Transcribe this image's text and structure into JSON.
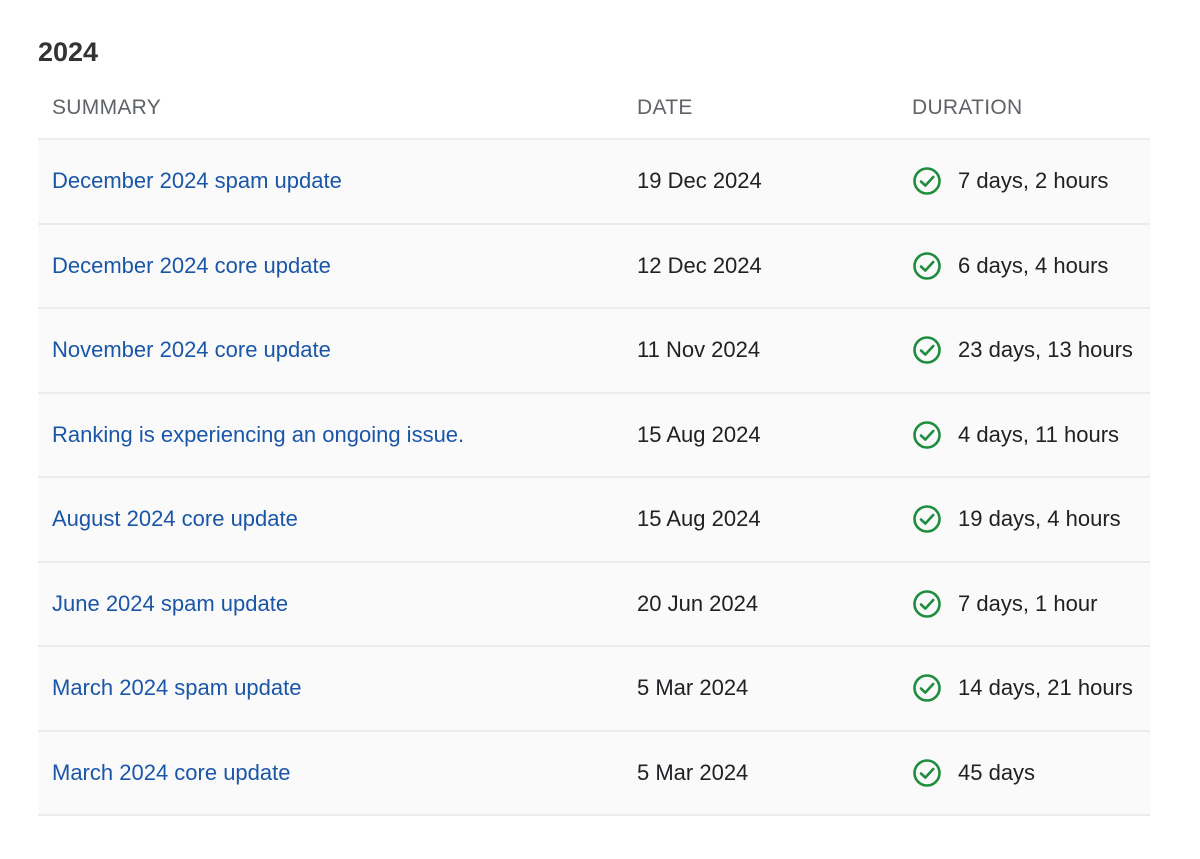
{
  "section": {
    "year": "2024"
  },
  "table": {
    "headers": {
      "summary": "SUMMARY",
      "date": "DATE",
      "duration": "DURATION"
    },
    "rows": [
      {
        "summary": "December 2024 spam update",
        "date": "19 Dec 2024",
        "duration": "7 days, 2 hours",
        "status_icon": "check-circle-icon"
      },
      {
        "summary": "December 2024 core update",
        "date": "12 Dec 2024",
        "duration": "6 days, 4 hours",
        "status_icon": "check-circle-icon"
      },
      {
        "summary": "November 2024 core update",
        "date": "11 Nov 2024",
        "duration": "23 days, 13 hours",
        "status_icon": "check-circle-icon"
      },
      {
        "summary": "Ranking is experiencing an ongoing issue.",
        "date": "15 Aug 2024",
        "duration": "4 days, 11 hours",
        "status_icon": "check-circle-icon"
      },
      {
        "summary": "August 2024 core update",
        "date": "15 Aug 2024",
        "duration": "19 days, 4 hours",
        "status_icon": "check-circle-icon"
      },
      {
        "summary": "June 2024 spam update",
        "date": "20 Jun 2024",
        "duration": "7 days, 1 hour",
        "status_icon": "check-circle-icon"
      },
      {
        "summary": "March 2024 spam update",
        "date": "5 Mar 2024",
        "duration": "14 days, 21 hours",
        "status_icon": "check-circle-icon"
      },
      {
        "summary": "March 2024 core update",
        "date": "5 Mar 2024",
        "duration": "45 days",
        "status_icon": "check-circle-icon"
      }
    ]
  },
  "colors": {
    "link": "#1a56a8",
    "status_resolved": "#1e8e3e",
    "row_background": "#fafafa",
    "divider": "#ececec"
  }
}
